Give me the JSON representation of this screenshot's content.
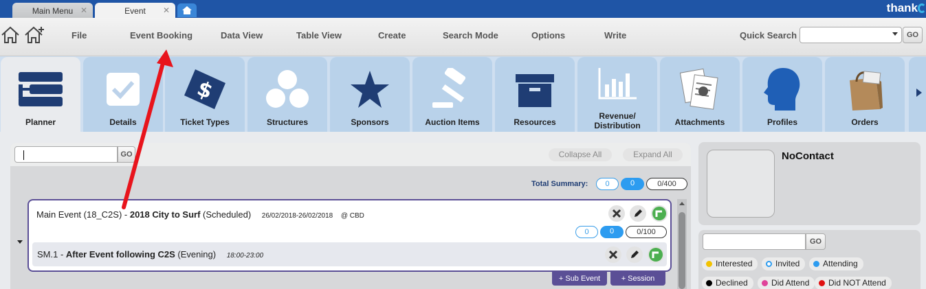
{
  "tabs": [
    {
      "label": "Main Menu",
      "close": "✕"
    },
    {
      "label": "Event",
      "close": "✕"
    }
  ],
  "brand": {
    "text": "thank"
  },
  "menu": {
    "items": [
      "File",
      "Event Booking",
      "Data View",
      "Table View",
      "Create",
      "Search Mode",
      "Options",
      "Write"
    ],
    "quick_search_label": "Quick Search",
    "go_label": "GO"
  },
  "ribbon": {
    "items": [
      {
        "label": "Planner",
        "icon": "planner-icon"
      },
      {
        "label": "Details",
        "icon": "checkbox-icon"
      },
      {
        "label": "Ticket Types",
        "icon": "ticket-icon"
      },
      {
        "label": "Structures",
        "icon": "structures-icon"
      },
      {
        "label": "Sponsors",
        "icon": "star-icon"
      },
      {
        "label": "Auction Items",
        "icon": "gavel-icon"
      },
      {
        "label": "Resources",
        "icon": "archive-box-icon"
      },
      {
        "label": "Revenue/ Distribution",
        "icon": "bar-chart-icon"
      },
      {
        "label": "Attachments",
        "icon": "attachments-icon"
      },
      {
        "label": "Profiles",
        "icon": "profile-head-icon"
      },
      {
        "label": "Orders",
        "icon": "shopping-bag-icon"
      }
    ]
  },
  "main": {
    "go_label": "GO",
    "collapse_all": "Collapse All",
    "expand_all": "Expand All",
    "total_summary_label": "Total Summary:",
    "total_counts": [
      "0",
      "0",
      "0/400"
    ],
    "event": {
      "prefix": "Main Event (18_C2S) - ",
      "name": "2018 City to Surf",
      "status": " (Scheduled)",
      "dates": "26/02/2018-26/02/2018",
      "location": "@ CBD",
      "counts": [
        "0",
        "0",
        "0/100"
      ]
    },
    "sub_event": {
      "prefix": "SM.1 - ",
      "name": "After Event following C2S",
      "status": " (Evening)",
      "time": "18:00-23:00"
    },
    "add_sub_event": "+ Sub Event",
    "add_session": "+ Session"
  },
  "contact": {
    "name": "NoContact"
  },
  "legend": {
    "go_label": "GO",
    "items": [
      {
        "label": "Interested",
        "color": "#f2c200"
      },
      {
        "label": "Invited",
        "color": "#2d9cf0"
      },
      {
        "label": "Attending",
        "color": "#2d9cf0"
      },
      {
        "label": "Declined",
        "color": "#000000"
      },
      {
        "label": "Did Attend",
        "color": "#e0449a"
      },
      {
        "label": "Did NOT Attend",
        "color": "#e01010"
      }
    ]
  },
  "colors": {
    "header_blue": "#1f55a6",
    "event_border": "#5b4f96",
    "count_blue": "#2d9cf0",
    "annotation_arrow": "#e8141c"
  }
}
